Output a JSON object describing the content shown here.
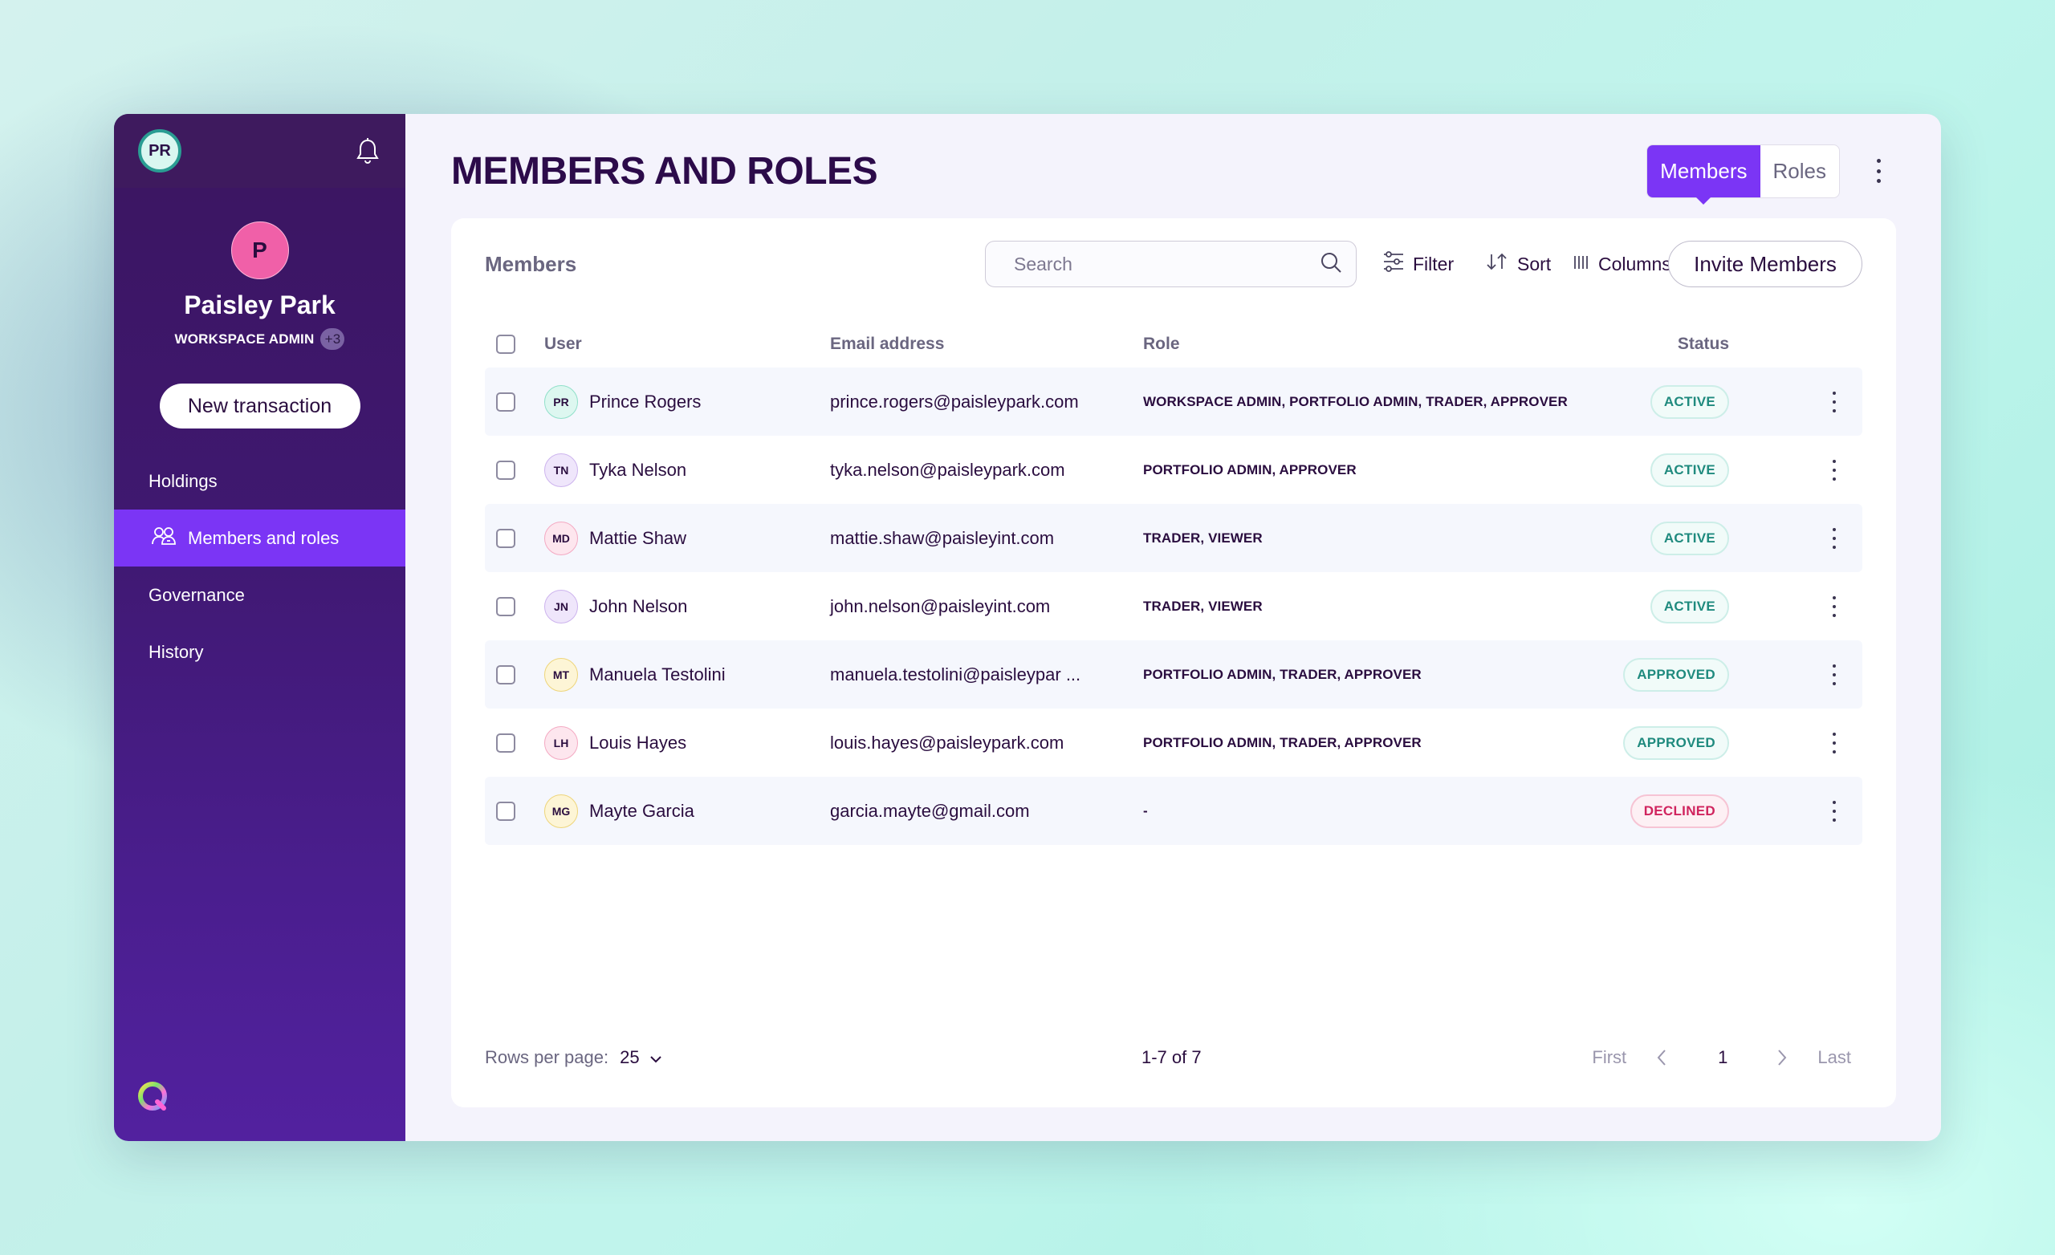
{
  "sidebar": {
    "user_initials": "PR",
    "org_initial": "P",
    "org_name": "Paisley Park",
    "org_role": "WORKSPACE ADMIN",
    "org_role_extra": "+3",
    "new_transaction_label": "New transaction",
    "nav": [
      {
        "label": "Holdings",
        "active": false
      },
      {
        "label": "Members and roles",
        "active": true,
        "icon": "users-icon"
      },
      {
        "label": "Governance",
        "active": false
      },
      {
        "label": "History",
        "active": false
      }
    ],
    "colors": {
      "active_item": "#7b35f5",
      "org_avatar": "#f060a8"
    }
  },
  "header": {
    "title": "MEMBERS AND ROLES",
    "tabs": [
      {
        "label": "Members",
        "active": true
      },
      {
        "label": "Roles",
        "active": false
      }
    ]
  },
  "card": {
    "title": "Members",
    "search_placeholder": "Search",
    "search_value": "",
    "filter_label": "Filter",
    "sort_label": "Sort",
    "columns_label": "Columns",
    "invite_label": "Invite Members"
  },
  "table": {
    "columns": [
      "User",
      "Email address",
      "Role",
      "Status"
    ],
    "rows": [
      {
        "initials": "PR",
        "name": "Prince Rogers",
        "email": "prince.rogers@paisleypark.com",
        "role": "WORKSPACE ADMIN, PORTFOLIO ADMIN, TRADER, APPROVER",
        "status": "ACTIVE",
        "avatar_color": "#ddf7f0",
        "avatar_border": "#8fe0c9"
      },
      {
        "initials": "TN",
        "name": "Tyka Nelson",
        "email": "tyka.nelson@paisleypark.com",
        "role": "PORTFOLIO ADMIN, APPROVER",
        "status": "ACTIVE",
        "avatar_color": "#efe6fb",
        "avatar_border": "#cdb4ee"
      },
      {
        "initials": "MD",
        "name": "Mattie Shaw",
        "email": "mattie.shaw@paisleyint.com",
        "role": "TRADER, VIEWER",
        "status": "ACTIVE",
        "avatar_color": "#fde6ee",
        "avatar_border": "#f4a9c2"
      },
      {
        "initials": "JN",
        "name": "John Nelson",
        "email": "john.nelson@paisleyint.com",
        "role": "TRADER, VIEWER",
        "status": "ACTIVE",
        "avatar_color": "#efe6fb",
        "avatar_border": "#cdb4ee"
      },
      {
        "initials": "MT",
        "name": "Manuela Testolini",
        "email": "manuela.testolini@paisleypar ...",
        "role": "PORTFOLIO ADMIN, TRADER, APPROVER",
        "status": "APPROVED",
        "avatar_color": "#fdf5d6",
        "avatar_border": "#eed57a"
      },
      {
        "initials": "LH",
        "name": "Louis Hayes",
        "email": "louis.hayes@paisleypark.com",
        "role": "PORTFOLIO ADMIN, TRADER, APPROVER",
        "status": "APPROVED",
        "avatar_color": "#fde6ee",
        "avatar_border": "#f4a9c2"
      },
      {
        "initials": "MG",
        "name": "Mayte Garcia",
        "email": "garcia.mayte@gmail.com",
        "role": "-",
        "status": "DECLINED",
        "avatar_color": "#fdf5d6",
        "avatar_border": "#eed57a"
      }
    ],
    "status_colors": {
      "ACTIVE": {
        "text": "#1f8a7e",
        "bg": "#f1fbf9",
        "border": "#cdeee8"
      },
      "APPROVED": {
        "text": "#1f8a7e",
        "bg": "#f1fbf9",
        "border": "#cdeee8"
      },
      "DECLINED": {
        "text": "#d0245e",
        "bg": "#fdf0f4",
        "border": "#f6c4d4"
      }
    }
  },
  "footer": {
    "rows_per_page_label": "Rows per page:",
    "rows_per_page_value": "25",
    "range": "1-7 of 7",
    "first_label": "First",
    "current_page": "1",
    "last_label": "Last"
  }
}
